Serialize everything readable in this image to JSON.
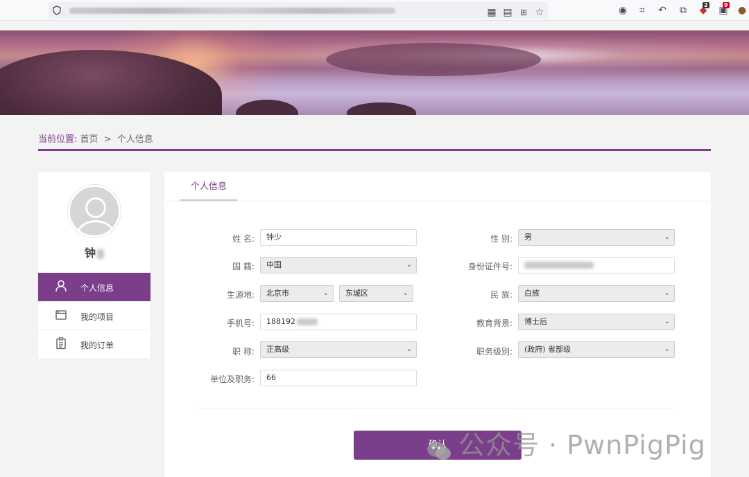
{
  "browser": {
    "toolbar_icons": [
      "shield-icon",
      "qr-code-icon",
      "reader-icon",
      "translate-icon",
      "star-icon",
      "account-icon",
      "crop-icon",
      "undo-icon",
      "extensions-icon",
      "extension-badge-icon",
      "extension-badge-icon",
      "cookie-icon"
    ],
    "badge_1": "2",
    "badge_2": "9"
  },
  "breadcrumb": {
    "current_label": "当前位置:",
    "home": "首页",
    "separator": ">",
    "page": "个人信息"
  },
  "sidebar": {
    "username": "钟",
    "menu": [
      {
        "label": "个人信息",
        "icon": "user-icon",
        "active": true
      },
      {
        "label": "我的项目",
        "icon": "project-icon",
        "active": false
      },
      {
        "label": "我的订单",
        "icon": "order-icon",
        "active": false
      }
    ]
  },
  "main": {
    "tab": "个人信息",
    "form": {
      "name_label": "姓 名:",
      "name_value": "钟少",
      "gender_label": "性 别:",
      "gender_value": "男",
      "nationality_label": "国 籍:",
      "nationality_value": "中国",
      "id_label": "身份证件号:",
      "origin_label": "生源地:",
      "province_value": "北京市",
      "district_value": "东城区",
      "ethnicity_label": "民 族:",
      "ethnicity_value": "白族",
      "phone_label": "手机号:",
      "phone_value": "188192",
      "education_label": "教育背景:",
      "education_value": "博士后",
      "title_label": "职 称:",
      "title_value": "正高级",
      "level_label": "职务级别:",
      "level_value": "(政府) 省部级",
      "org_label": "单位及职务:",
      "org_value": "66"
    },
    "confirm_label": "确认"
  },
  "watermark": "公众号 · PwnPigPig",
  "colors": {
    "accent": "#7b3e8a",
    "background": "#f3f3f3"
  }
}
